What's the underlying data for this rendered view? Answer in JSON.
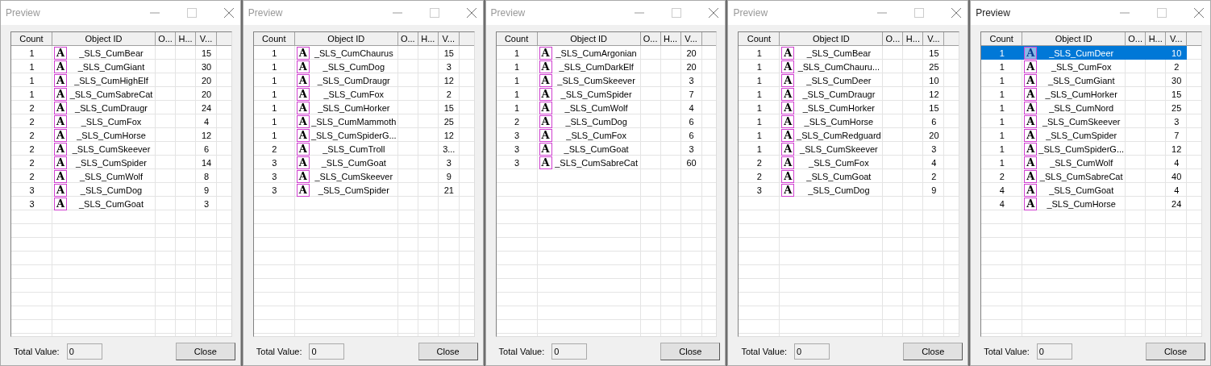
{
  "windows": [
    {
      "title": "Preview",
      "active": false,
      "columns": [
        "Count",
        "Object ID",
        "O...",
        "H...",
        "V..."
      ],
      "rows": [
        {
          "count": "1",
          "icon": "A",
          "object_id": "_SLS_CumBear",
          "value": "15",
          "selected": false
        },
        {
          "count": "1",
          "icon": "A",
          "object_id": "_SLS_CumGiant",
          "value": "30",
          "selected": false
        },
        {
          "count": "1",
          "icon": "A",
          "object_id": "_SLS_CumHighElf",
          "value": "20",
          "selected": false
        },
        {
          "count": "1",
          "icon": "A",
          "object_id": "_SLS_CumSabreCat",
          "value": "20",
          "selected": false
        },
        {
          "count": "2",
          "icon": "A",
          "object_id": "_SLS_CumDraugr",
          "value": "24",
          "selected": false
        },
        {
          "count": "2",
          "icon": "A",
          "object_id": "_SLS_CumFox",
          "value": "4",
          "selected": false
        },
        {
          "count": "2",
          "icon": "A",
          "object_id": "_SLS_CumHorse",
          "value": "12",
          "selected": false
        },
        {
          "count": "2",
          "icon": "A",
          "object_id": "_SLS_CumSkeever",
          "value": "6",
          "selected": false
        },
        {
          "count": "2",
          "icon": "A",
          "object_id": "_SLS_CumSpider",
          "value": "14",
          "selected": false
        },
        {
          "count": "2",
          "icon": "A",
          "object_id": "_SLS_CumWolf",
          "value": "8",
          "selected": false
        },
        {
          "count": "3",
          "icon": "A",
          "object_id": "_SLS_CumDog",
          "value": "9",
          "selected": false
        },
        {
          "count": "3",
          "icon": "A",
          "object_id": "_SLS_CumGoat",
          "value": "3",
          "selected": false
        }
      ],
      "total_label": "Total Value:",
      "total_value": "0",
      "close_button": "Close"
    },
    {
      "title": "Preview",
      "active": false,
      "columns": [
        "Count",
        "Object ID",
        "O...",
        "H...",
        "V..."
      ],
      "rows": [
        {
          "count": "1",
          "icon": "A",
          "object_id": "_SLS_CumChaurus",
          "value": "15",
          "selected": false
        },
        {
          "count": "1",
          "icon": "A",
          "object_id": "_SLS_CumDog",
          "value": "3",
          "selected": false
        },
        {
          "count": "1",
          "icon": "A",
          "object_id": "_SLS_CumDraugr",
          "value": "12",
          "selected": false
        },
        {
          "count": "1",
          "icon": "A",
          "object_id": "_SLS_CumFox",
          "value": "2",
          "selected": false
        },
        {
          "count": "1",
          "icon": "A",
          "object_id": "_SLS_CumHorker",
          "value": "15",
          "selected": false
        },
        {
          "count": "1",
          "icon": "A",
          "object_id": "_SLS_CumMammoth",
          "value": "25",
          "selected": false
        },
        {
          "count": "1",
          "icon": "A",
          "object_id": "_SLS_CumSpiderG...",
          "value": "12",
          "selected": false
        },
        {
          "count": "2",
          "icon": "A",
          "object_id": "_SLS_CumTroll",
          "value": "3...",
          "selected": false
        },
        {
          "count": "3",
          "icon": "A",
          "object_id": "_SLS_CumGoat",
          "value": "3",
          "selected": false
        },
        {
          "count": "3",
          "icon": "A",
          "object_id": "_SLS_CumSkeever",
          "value": "9",
          "selected": false
        },
        {
          "count": "3",
          "icon": "A",
          "object_id": "_SLS_CumSpider",
          "value": "21",
          "selected": false
        }
      ],
      "total_label": "Total Value:",
      "total_value": "0",
      "close_button": "Close"
    },
    {
      "title": "Preview",
      "active": false,
      "columns": [
        "Count",
        "Object ID",
        "O...",
        "H...",
        "V..."
      ],
      "rows": [
        {
          "count": "1",
          "icon": "A",
          "object_id": "_SLS_CumArgonian",
          "value": "20",
          "selected": false
        },
        {
          "count": "1",
          "icon": "A",
          "object_id": "_SLS_CumDarkElf",
          "value": "20",
          "selected": false
        },
        {
          "count": "1",
          "icon": "A",
          "object_id": "_SLS_CumSkeever",
          "value": "3",
          "selected": false
        },
        {
          "count": "1",
          "icon": "A",
          "object_id": "_SLS_CumSpider",
          "value": "7",
          "selected": false
        },
        {
          "count": "1",
          "icon": "A",
          "object_id": "_SLS_CumWolf",
          "value": "4",
          "selected": false
        },
        {
          "count": "2",
          "icon": "A",
          "object_id": "_SLS_CumDog",
          "value": "6",
          "selected": false
        },
        {
          "count": "3",
          "icon": "A",
          "object_id": "_SLS_CumFox",
          "value": "6",
          "selected": false
        },
        {
          "count": "3",
          "icon": "A",
          "object_id": "_SLS_CumGoat",
          "value": "3",
          "selected": false
        },
        {
          "count": "3",
          "icon": "A",
          "object_id": "_SLS_CumSabreCat",
          "value": "60",
          "selected": false
        }
      ],
      "total_label": "Total Value:",
      "total_value": "0",
      "close_button": "Close"
    },
    {
      "title": "Preview",
      "active": false,
      "columns": [
        "Count",
        "Object ID",
        "O...",
        "H...",
        "V..."
      ],
      "rows": [
        {
          "count": "1",
          "icon": "A",
          "object_id": "_SLS_CumBear",
          "value": "15",
          "selected": false
        },
        {
          "count": "1",
          "icon": "A",
          "object_id": "_SLS_CumChauru...",
          "value": "25",
          "selected": false
        },
        {
          "count": "1",
          "icon": "A",
          "object_id": "_SLS_CumDeer",
          "value": "10",
          "selected": false
        },
        {
          "count": "1",
          "icon": "A",
          "object_id": "_SLS_CumDraugr",
          "value": "12",
          "selected": false
        },
        {
          "count": "1",
          "icon": "A",
          "object_id": "_SLS_CumHorker",
          "value": "15",
          "selected": false
        },
        {
          "count": "1",
          "icon": "A",
          "object_id": "_SLS_CumHorse",
          "value": "6",
          "selected": false
        },
        {
          "count": "1",
          "icon": "A",
          "object_id": "_SLS_CumRedguard",
          "value": "20",
          "selected": false
        },
        {
          "count": "1",
          "icon": "A",
          "object_id": "_SLS_CumSkeever",
          "value": "3",
          "selected": false
        },
        {
          "count": "2",
          "icon": "A",
          "object_id": "_SLS_CumFox",
          "value": "4",
          "selected": false
        },
        {
          "count": "2",
          "icon": "A",
          "object_id": "_SLS_CumGoat",
          "value": "2",
          "selected": false
        },
        {
          "count": "3",
          "icon": "A",
          "object_id": "_SLS_CumDog",
          "value": "9",
          "selected": false
        }
      ],
      "total_label": "Total Value:",
      "total_value": "0",
      "close_button": "Close"
    },
    {
      "title": "Preview",
      "active": true,
      "columns": [
        "Count",
        "Object ID",
        "O...",
        "H...",
        "V..."
      ],
      "rows": [
        {
          "count": "1",
          "icon": "A",
          "object_id": "_SLS_CumDeer",
          "value": "10",
          "selected": true
        },
        {
          "count": "1",
          "icon": "A",
          "object_id": "_SLS_CumFox",
          "value": "2",
          "selected": false
        },
        {
          "count": "1",
          "icon": "A",
          "object_id": "_SLS_CumGiant",
          "value": "30",
          "selected": false
        },
        {
          "count": "1",
          "icon": "A",
          "object_id": "_SLS_CumHorker",
          "value": "15",
          "selected": false
        },
        {
          "count": "1",
          "icon": "A",
          "object_id": "_SLS_CumNord",
          "value": "25",
          "selected": false
        },
        {
          "count": "1",
          "icon": "A",
          "object_id": "_SLS_CumSkeever",
          "value": "3",
          "selected": false
        },
        {
          "count": "1",
          "icon": "A",
          "object_id": "_SLS_CumSpider",
          "value": "7",
          "selected": false
        },
        {
          "count": "1",
          "icon": "A",
          "object_id": "_SLS_CumSpiderG...",
          "value": "12",
          "selected": false
        },
        {
          "count": "1",
          "icon": "A",
          "object_id": "_SLS_CumWolf",
          "value": "4",
          "selected": false
        },
        {
          "count": "2",
          "icon": "A",
          "object_id": "_SLS_CumSabreCat",
          "value": "40",
          "selected": false
        },
        {
          "count": "4",
          "icon": "A",
          "object_id": "_SLS_CumGoat",
          "value": "4",
          "selected": false
        },
        {
          "count": "4",
          "icon": "A",
          "object_id": "_SLS_CumHorse",
          "value": "24",
          "selected": false
        }
      ],
      "total_label": "Total Value:",
      "total_value": "0",
      "close_button": "Close"
    }
  ]
}
